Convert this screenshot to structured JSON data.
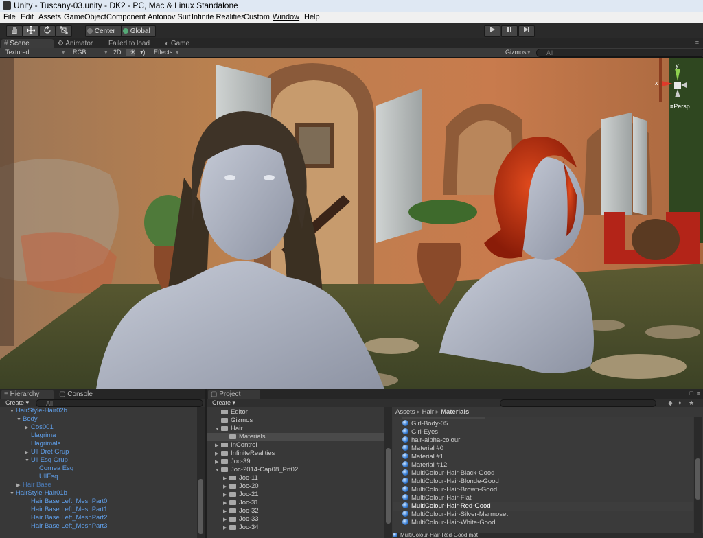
{
  "window": {
    "title": "Unity - Tuscany-03.unity - DK2 - PC, Mac & Linux Standalone"
  },
  "menu": [
    "File",
    "Edit",
    "Assets",
    "GameObject",
    "Component",
    "Antonov Suit",
    "Infinite Realities",
    "Custom",
    "Window",
    "Help"
  ],
  "toolbar": {
    "tools": [
      "hand-icon",
      "move-icon",
      "rotate-icon",
      "scale-icon"
    ],
    "pivot_mode": "Center",
    "pivot_rotation": "Global",
    "play": [
      "play-icon",
      "pause-icon",
      "step-icon"
    ]
  },
  "scene_tabs": [
    "Scene",
    "Animator",
    "Failed to load",
    "Game"
  ],
  "scene_options": {
    "render_mode": "Textured",
    "color_mode": "RGB",
    "mode_2d": "2D",
    "effects": "Effects",
    "gizmos": "Gizmos",
    "search_placeholder": "All"
  },
  "gizmo": {
    "x_label": "x",
    "y_label": "y",
    "projection": "Persp"
  },
  "hierarchy": {
    "tabs": [
      "Hierarchy",
      "Console"
    ],
    "create_label": "Create",
    "search_placeholder": "All",
    "items": [
      {
        "label": "HairStyle-Hair02b",
        "expand": "open"
      },
      {
        "label": "Body",
        "expand": "open"
      },
      {
        "label": "Cos001",
        "expand": "closed"
      },
      {
        "label": "Llagrima",
        "expand": ""
      },
      {
        "label": "Llagrimals",
        "expand": ""
      },
      {
        "label": "Ull Dret Grup",
        "expand": "closed"
      },
      {
        "label": "Ull Esq Grup",
        "expand": "open"
      },
      {
        "label": "Cornea Esq",
        "expand": ""
      },
      {
        "label": "UllEsq",
        "expand": ""
      },
      {
        "label": "Hair Base",
        "expand": "closed"
      },
      {
        "label": "HairStyle-Hair01b",
        "expand": "open"
      },
      {
        "label": "Hair Base Left_MeshPart0",
        "expand": ""
      },
      {
        "label": "Hair Base Left_MeshPart1",
        "expand": ""
      },
      {
        "label": "Hair Base Left_MeshPart2",
        "expand": ""
      },
      {
        "label": "Hair Base Left_MeshPart3",
        "expand": ""
      }
    ]
  },
  "project": {
    "tab": "Project",
    "create_label": "Create",
    "search_placeholder": "",
    "folders": [
      {
        "label": "Editor",
        "expand": ""
      },
      {
        "label": "Gizmos",
        "expand": ""
      },
      {
        "label": "Hair",
        "expand": "open"
      },
      {
        "label": "Materials",
        "expand": ""
      },
      {
        "label": "InControl",
        "expand": "closed"
      },
      {
        "label": "InfiniteRealities",
        "expand": "closed"
      },
      {
        "label": "Joc-39",
        "expand": "closed"
      },
      {
        "label": "Joc-2014-Cap08_Prt02",
        "expand": "open"
      },
      {
        "label": "Joc-11",
        "expand": "closed"
      },
      {
        "label": "Joc-20",
        "expand": "closed"
      },
      {
        "label": "Joc-21",
        "expand": "closed"
      },
      {
        "label": "Joc-31",
        "expand": "closed"
      },
      {
        "label": "Joc-32",
        "expand": "closed"
      },
      {
        "label": "Joc-33",
        "expand": "closed"
      },
      {
        "label": "Joc-34",
        "expand": "closed"
      }
    ],
    "breadcrumb": [
      "Assets",
      "Hair",
      "Materials"
    ],
    "materials": [
      "Girl-Body-05",
      "Girl-Eyes",
      "hair-alpha-colour",
      "Material #0",
      "Material #1",
      "Material #12",
      "MultiColour-Hair-Black-Good",
      "MultiColour-Hair-Blonde-Good",
      "MultiColour-Hair-Brown-Good",
      "MultiColour-Hair-Flat",
      "MultiColour-Hair-Red-Good",
      "MultiColour-Hair-Silver-Marmoset",
      "MultiColour-Hair-White-Good"
    ],
    "selected_file": "MultiColour-Hair-Red-Good.mat"
  }
}
